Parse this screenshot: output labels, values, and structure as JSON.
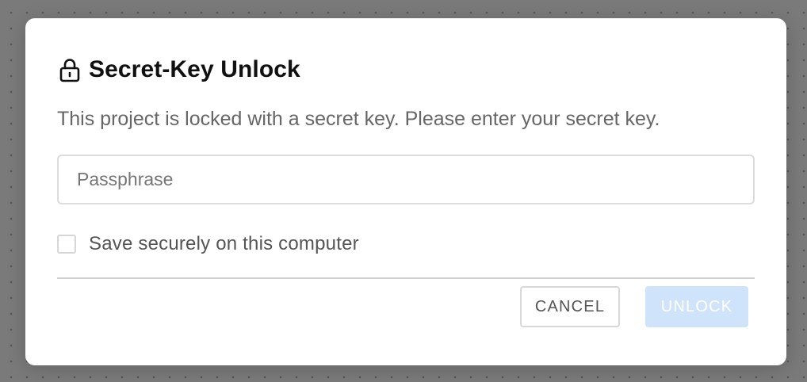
{
  "dialog": {
    "title": "Secret-Key Unlock",
    "title_icon": "lock-icon",
    "description": "This project is locked with a secret key. Please enter your secret key.",
    "passphrase": {
      "value": "",
      "placeholder": "Passphrase"
    },
    "save_checkbox": {
      "label": "Save securely on this computer",
      "checked": false
    },
    "buttons": {
      "cancel_label": "CANCEL",
      "unlock_label": "UNLOCK",
      "unlock_disabled": true
    }
  },
  "colors": {
    "backdrop": "#7a7a7a",
    "modal_background": "#ffffff",
    "unlock_disabled_background": "#cfe3fb",
    "text_primary": "#111111",
    "text_secondary": "#666666"
  }
}
